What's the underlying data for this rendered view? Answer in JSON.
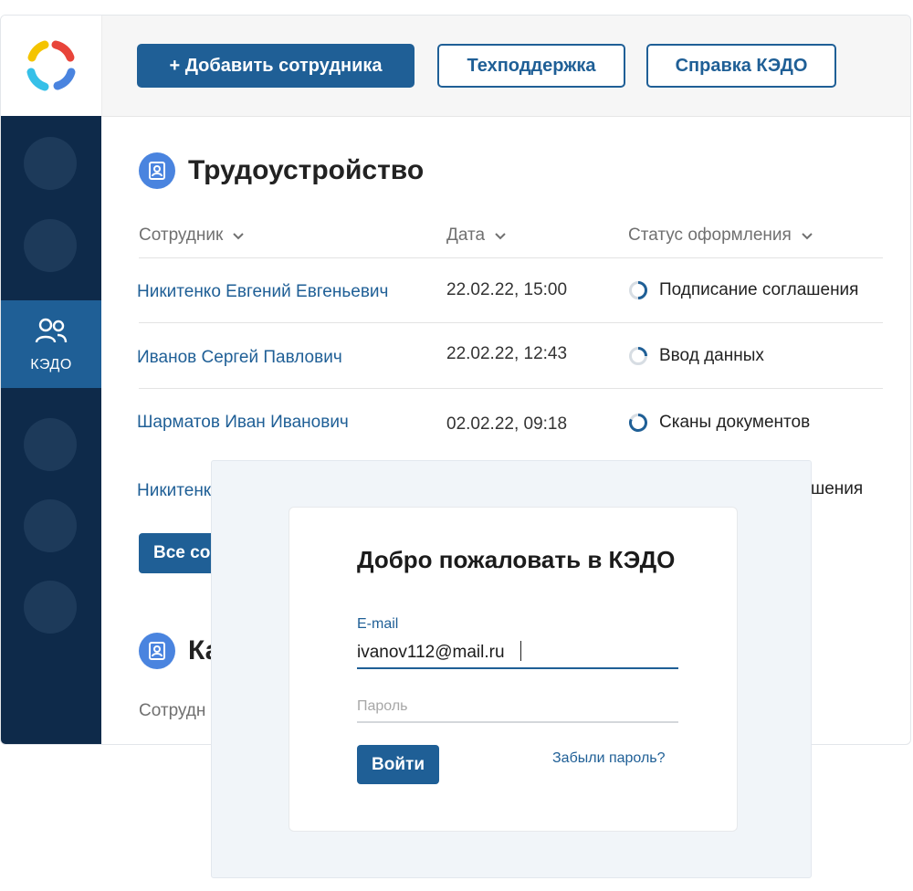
{
  "toolbar": {
    "add_employee": "+ Добавить сотрудника",
    "support": "Техподдержка",
    "help": "Справка КЭДО"
  },
  "sidebar": {
    "active_item": {
      "label": "КЭДО",
      "icon": "users-icon"
    }
  },
  "employment": {
    "title": "Трудоустройство",
    "columns": [
      "Сотрудник",
      "Дата",
      "Статус оформления"
    ],
    "rows": [
      {
        "name": "Никитенко Евгений Евгеньевич",
        "date": "22.02.22, 15:00",
        "status": "Подписание соглашения"
      },
      {
        "name": "Иванов Сергей Павлович",
        "date": "22.02.22, 12:43",
        "status": "Ввод данных"
      },
      {
        "name": "Шарматов Иван Иванович",
        "date": "02.02.22, 09:18",
        "status": "Сканы документов"
      },
      {
        "name": "Никитенк",
        "date": "",
        "status": "шения"
      }
    ],
    "all_button": "Все со"
  },
  "second_section": {
    "title": "Ка",
    "column": "Сотрудн"
  },
  "login": {
    "title": "Добро пожаловать в КЭДО",
    "email_label": "E-mail",
    "email_value": "ivanov112@mail.ru",
    "password_placeholder": "Пароль",
    "submit": "Войти",
    "forgot": "Забыли пароль?"
  },
  "colors": {
    "primary": "#1f5f96",
    "sidebar": "#0e2a4a",
    "accent_icon": "#4a84df"
  }
}
